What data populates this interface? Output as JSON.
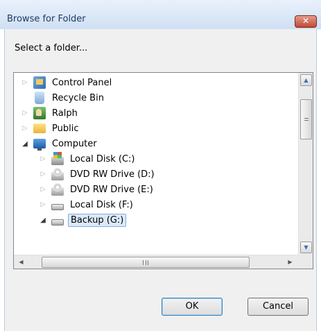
{
  "window": {
    "title": "Browse for Folder",
    "close_glyph": "✕"
  },
  "prompt": "Select a folder...",
  "tree": {
    "items": [
      {
        "label": "Control Panel",
        "icon": "control-panel-icon",
        "expander": "▷"
      },
      {
        "label": "Recycle Bin",
        "icon": "recycle-bin-icon",
        "expander": ""
      },
      {
        "label": "Ralph",
        "icon": "user-folder-icon",
        "expander": "▷"
      },
      {
        "label": "Public",
        "icon": "folder-icon",
        "expander": "▷"
      },
      {
        "label": "Computer",
        "icon": "computer-icon",
        "expander": "◢"
      },
      {
        "label": "Local Disk (C:)",
        "icon": "windows-drive-icon",
        "expander": "▷"
      },
      {
        "label": "DVD RW Drive (D:)",
        "icon": "dvd-drive-icon",
        "expander": "▷"
      },
      {
        "label": "DVD RW Drive (E:)",
        "icon": "dvd-drive-icon",
        "expander": "▷"
      },
      {
        "label": "Local Disk (F:)",
        "icon": "drive-icon",
        "expander": "▷"
      },
      {
        "label": "Backup (G:)",
        "icon": "drive-icon",
        "expander": "◢",
        "selected": true
      }
    ]
  },
  "scrollbars": {
    "up_glyph": "▲",
    "down_glyph": "▼",
    "left_glyph": "◀",
    "right_glyph": "▶",
    "grip_glyph": "III"
  },
  "buttons": {
    "ok": "OK",
    "cancel": "Cancel"
  },
  "colors": {
    "title_text": "#1e3966",
    "selection": "#dbeaf9",
    "close_button": "#c24a36"
  }
}
